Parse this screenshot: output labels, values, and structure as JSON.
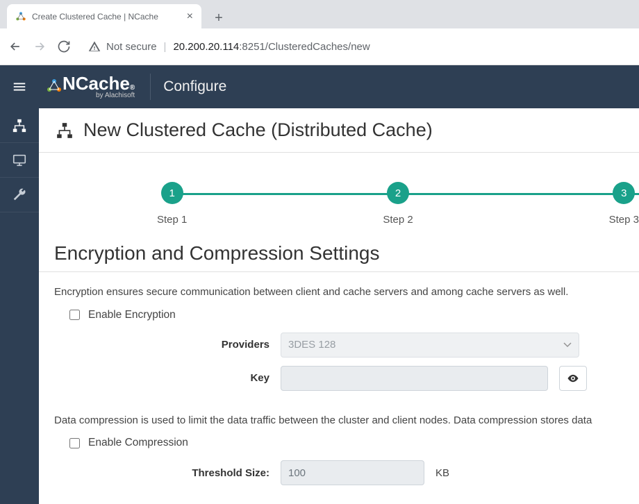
{
  "browser": {
    "tab_title": "Create Clustered Cache | NCache",
    "security_text": "Not secure",
    "url_host": "20.200.20.114",
    "url_rest": ":8251/ClusteredCaches/new"
  },
  "header": {
    "brand_main": "NCache",
    "brand_sup": "®",
    "brand_sub": "by Alachisoft",
    "section": "Configure"
  },
  "page": {
    "title": "New Clustered Cache (Distributed Cache)"
  },
  "stepper": {
    "steps": [
      {
        "num": "1",
        "label": "Step 1"
      },
      {
        "num": "2",
        "label": "Step 2"
      },
      {
        "num": "3",
        "label": "Step 3"
      }
    ]
  },
  "section": {
    "title": "Encryption and Compression Settings",
    "encryption_desc": "Encryption ensures secure communication between client and cache servers and among cache servers as well.",
    "enable_encryption": "Enable Encryption",
    "providers_label": "Providers",
    "providers_value": "3DES 128",
    "key_label": "Key",
    "key_value": "",
    "compression_desc": "Data compression is used to limit the data traffic between the cluster and client nodes. Data compression stores data",
    "enable_compression": "Enable Compression",
    "threshold_label": "Threshold Size:",
    "threshold_value": "100",
    "threshold_unit": "KB"
  }
}
